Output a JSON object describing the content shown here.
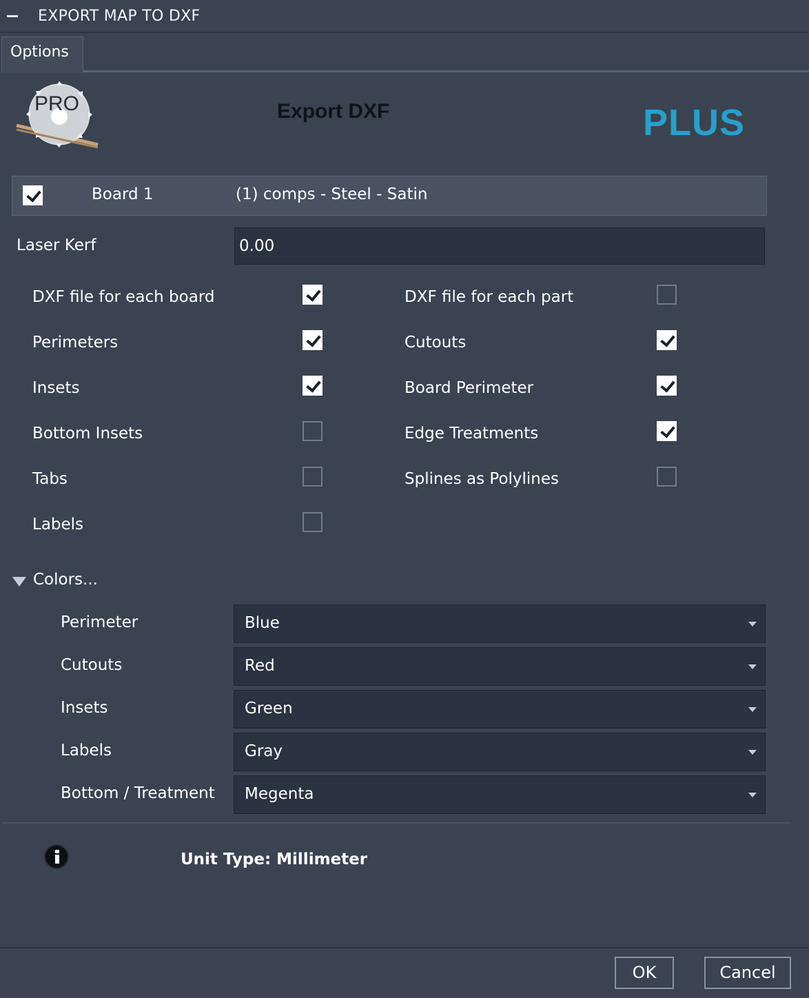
{
  "window": {
    "title": "EXPORT MAP TO DXF"
  },
  "tabs": [
    {
      "label": "Options",
      "active": true
    }
  ],
  "header": {
    "logo_text": "PRO",
    "title": "Export DXF",
    "edition": "PLUS"
  },
  "board": {
    "checked": true,
    "name": "Board 1",
    "description": "(1) comps - Steel - Satin"
  },
  "laser_kerf": {
    "label": "Laser Kerf",
    "value": "0.00"
  },
  "options_left": [
    {
      "label": "DXF file for each board",
      "checked": true
    },
    {
      "label": "Perimeters",
      "checked": true
    },
    {
      "label": "Insets",
      "checked": true
    },
    {
      "label": "Bottom Insets",
      "checked": false
    },
    {
      "label": "Tabs",
      "checked": false
    },
    {
      "label": "Labels",
      "checked": false
    }
  ],
  "options_right": [
    {
      "label": "DXF file for each part",
      "checked": false
    },
    {
      "label": "Cutouts",
      "checked": true
    },
    {
      "label": "Board Perimeter",
      "checked": true
    },
    {
      "label": "Edge Treatments",
      "checked": true
    },
    {
      "label": "Splines as Polylines",
      "checked": false
    }
  ],
  "colors": {
    "section_label": "Colors...",
    "expanded": true,
    "rows": [
      {
        "label": "Perimeter",
        "value": "Blue"
      },
      {
        "label": "Cutouts",
        "value": "Red"
      },
      {
        "label": "Insets",
        "value": "Green"
      },
      {
        "label": "Labels",
        "value": "Gray"
      },
      {
        "label": "Bottom / Treatment",
        "value": "Megenta"
      }
    ]
  },
  "info": {
    "icon": "info-icon",
    "unit_type": "Unit Type: Millimeter"
  },
  "buttons": {
    "ok": "OK",
    "cancel": "Cancel"
  },
  "theme": {
    "background": "#3b4351",
    "field": "#2c3340",
    "accent": "#27a0cc"
  }
}
